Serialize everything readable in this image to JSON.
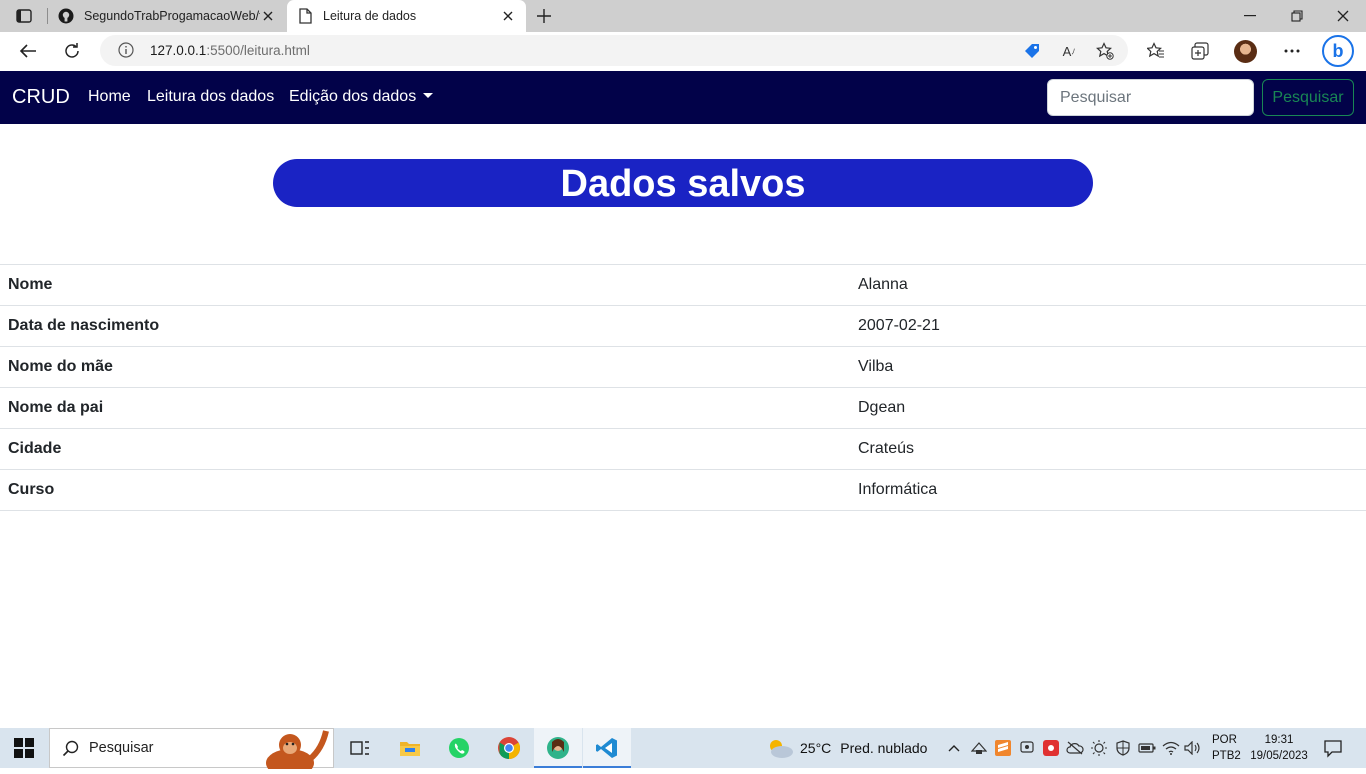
{
  "browser": {
    "tabs": [
      {
        "title": "SegundoTrabProgamacaoWeb/te",
        "icon": "github-icon",
        "active": false
      },
      {
        "title": "Leitura de dados",
        "icon": "page-icon",
        "active": true
      }
    ],
    "url_host": "127.0.0.1",
    "url_rest": ":5500/leitura.html"
  },
  "navbar": {
    "brand": "CRUD",
    "links": [
      "Home",
      "Leitura dos dados",
      "Edição dos dados"
    ],
    "search_placeholder": "Pesquisar",
    "search_button": "Pesquisar"
  },
  "main": {
    "title": "Dados salvos",
    "rows": [
      {
        "label": "Nome",
        "value": "Alanna"
      },
      {
        "label": "Data de nascimento",
        "value": "2007-02-21"
      },
      {
        "label": "Nome do mãe",
        "value": "Vilba"
      },
      {
        "label": "Nome da pai",
        "value": "Dgean"
      },
      {
        "label": "Cidade",
        "value": "Crateús"
      },
      {
        "label": "Curso",
        "value": "Informática"
      }
    ]
  },
  "taskbar": {
    "search_placeholder": "Pesquisar",
    "weather_temp": "25°C",
    "weather_condition": "Pred. nublado",
    "lang_line1": "POR",
    "lang_line2": "PTB2",
    "time": "19:31",
    "date": "19/05/2023",
    "apps": [
      "task-view-icon",
      "file-explorer-icon",
      "whatsapp-icon",
      "chrome-icon",
      "edge-profile-icon",
      "vscode-icon"
    ]
  },
  "colors": {
    "navbar_bg": "#020249",
    "title_bg": "#1a23c4",
    "search_button": "#198754"
  }
}
